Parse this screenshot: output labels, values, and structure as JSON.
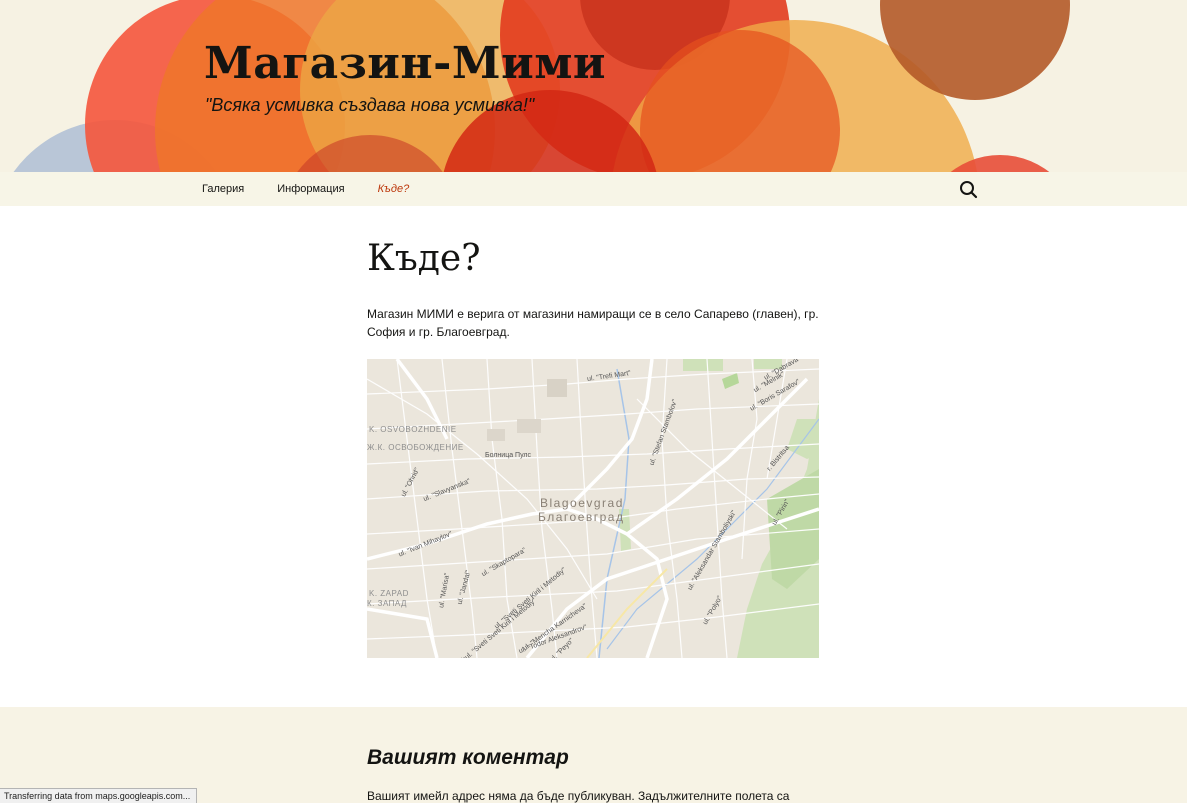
{
  "header": {
    "site_title": "Магазин-Мими",
    "site_description": "\"Всяка усмивка създава нова усмивка!\""
  },
  "nav": {
    "items": [
      {
        "label": "Галерия",
        "current": false
      },
      {
        "label": "Информация",
        "current": false
      },
      {
        "label": "Къде?",
        "current": true
      }
    ],
    "search_icon": "search-icon"
  },
  "page": {
    "title": "Къде?",
    "text": "Магазин МИМИ е верига от магазини намиращи се в село Сапарево (главен), гр. София и гр. Благоевград."
  },
  "map": {
    "city_latin": "Blagoevgrad",
    "city_cyrillic": "Благоевград",
    "district_1_latin": "K. OSVOBOZHDENIE",
    "district_1_cyrillic": "Ж.К. ОСВОБОЖДЕНИЕ",
    "district_2_latin": "K. ZAPAD",
    "district_2_cyrillic": "К. ЗАПАД",
    "poi": "Болница Пулс",
    "streets": {
      "trefi_mart": "ul. \"Trefi Mart\"",
      "dabrava": "ul. \"Dabrava\"",
      "melnik": "ul. \"Melnik\"",
      "boris_sarafov": "ul. \"Boris Sarafov\"",
      "stefan_stambolov": "ul. \"Stefan Stambolov\"",
      "slavyanska": "ul. \"Slavyanska\"",
      "ohrid": "ul. \"Ohrid\"",
      "ivan_mihaylov": "ul. \"Ivan Mihaylov\"",
      "skaptopara": "ul. \"Skaptopara\"",
      "marisa": "ul. \"Marisa\"",
      "jandal": "ul. \"Jandal\"",
      "kiril_metodiy": "ul. \"Sveti Sveti Kiril i Metodiy\"",
      "kiril_metodiy_bul": "bul. \"Sveti Sveti Kiril i Metodiy\"",
      "mencha": "ul. \"Mencha Karnicheva\"",
      "todor": "ul. \"Todor Aleksandrov\"",
      "aleksandar": "ul. \"Aleksandar Stamboliyski\"",
      "polyo": "ul. \"Polyo\"",
      "bistritsa": "r. Bistritsa",
      "pirin": "ul. \"Pirin\"",
      "peyo": "ul. \"Peyo\""
    }
  },
  "comments": {
    "reply_title": "Вашият коментар",
    "notes": "Вашият имейл адрес няма да бъде публикуван. Задължителните полета са"
  },
  "browser": {
    "status_text": "Transferring data from maps.googleapis.com..."
  },
  "colors": {
    "accent": "#bc360a",
    "header_bg": "#f6f2e3",
    "body_bg": "#ffffff",
    "footer_bg": "#f7f3e5"
  }
}
